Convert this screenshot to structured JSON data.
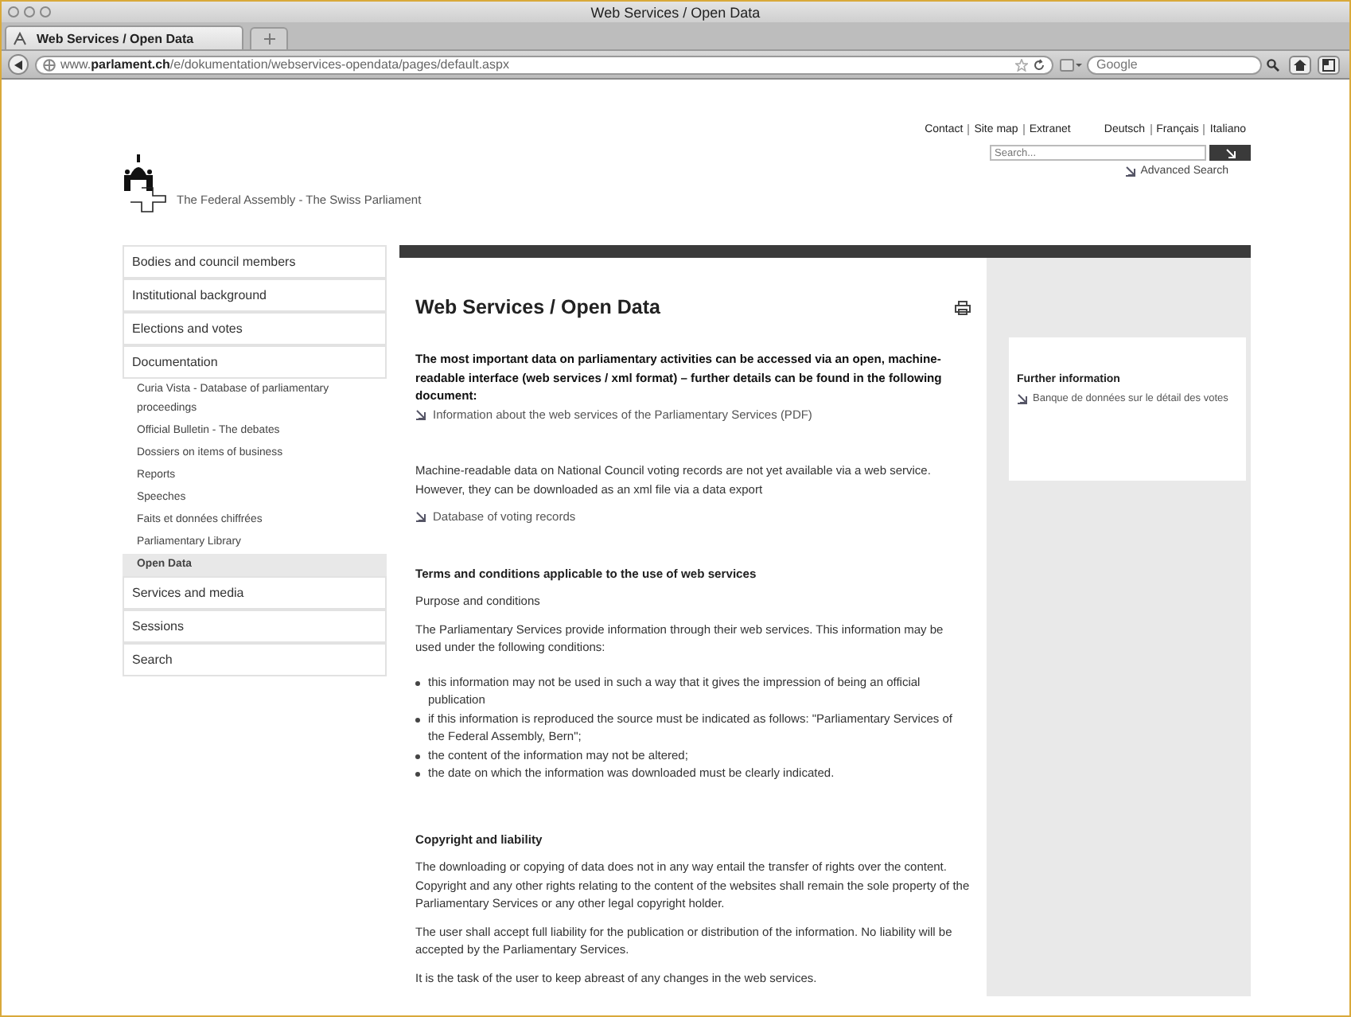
{
  "window": {
    "title": "Web Services / Open Data"
  },
  "tabs": [
    {
      "label": "Web Services / Open Data",
      "selected": true
    }
  ],
  "address_bar": {
    "url": "www.**parlament.ch**/e/dokumentation/webservices-opendata/pages/default.aspx"
  },
  "browser_search": {
    "placeholder": "Google"
  },
  "header": {
    "top_links": [
      "Contact",
      "Site map",
      "Extranet"
    ],
    "languages": [
      "Deutsch",
      "Français",
      "Italiano"
    ],
    "search": {
      "placeholder": "Search..."
    },
    "advanced_search": "Advanced Search",
    "brand": "The Federal Assembly - The Swiss Parliament"
  },
  "sidebar": {
    "items": [
      {
        "label": "Bodies and council members",
        "kind": "main",
        "selected": false
      },
      {
        "label": "Institutional background",
        "kind": "main",
        "selected": false
      },
      {
        "label": "Elections and votes",
        "kind": "main",
        "selected": false
      },
      {
        "label": "Documentation",
        "kind": "main",
        "selected": false
      },
      {
        "label": "Curia Vista - Database of parliamentary proceedings",
        "kind": "sub",
        "selected": false
      },
      {
        "label": "Official Bulletin - The debates",
        "kind": "sub",
        "selected": false
      },
      {
        "label": "Dossiers on items of business",
        "kind": "sub",
        "selected": false
      },
      {
        "label": "Reports",
        "kind": "sub",
        "selected": false
      },
      {
        "label": "Speeches",
        "kind": "sub",
        "selected": false
      },
      {
        "label": "Faits et données chiffrées",
        "kind": "sub",
        "selected": false
      },
      {
        "label": "Parliamentary Library",
        "kind": "sub",
        "selected": false
      },
      {
        "label": "Open Data",
        "kind": "sub",
        "selected": true
      },
      {
        "label": "Services and media",
        "kind": "main",
        "selected": false
      },
      {
        "label": "Sessions",
        "kind": "main",
        "selected": false
      },
      {
        "label": "Search",
        "kind": "main",
        "selected": false
      }
    ]
  },
  "content": {
    "title": "Web Services / Open Data",
    "blocks": [
      {
        "kind": "intro",
        "text": "The most important data on parliamentary activities can be accessed via an open, machine-readable interface (web services / xml format) – further details can be found in the following document:"
      },
      {
        "kind": "link",
        "text": "Information about the web services of the Parliamentary Services (PDF)"
      },
      {
        "kind": "gap"
      },
      {
        "kind": "para",
        "text": "Machine-readable data on National Council voting records are not yet available via a web service. However, they can be downloaded as an xml file via a data export"
      },
      {
        "kind": "link",
        "text": "Database of voting records"
      },
      {
        "kind": "gap"
      },
      {
        "kind": "heading",
        "text": "Terms and conditions applicable to the use of web services"
      },
      {
        "kind": "para",
        "text": "Purpose and conditions"
      },
      {
        "kind": "para",
        "text": "The Parliamentary Services provide information through their web services. This information may be used under the following conditions:"
      },
      {
        "kind": "bullets",
        "items": [
          "this information may not be used in such a way that it gives the impression of being an official publication",
          "if this information is reproduced the source must be indicated as follows: \"Parliamentary Services of the Federal Assembly, Bern\";",
          "the content of the information may not be altered;",
          "the date on which the information was downloaded must be clearly indicated."
        ]
      },
      {
        "kind": "gap"
      },
      {
        "kind": "heading",
        "text": "Copyright and liability"
      },
      {
        "kind": "para",
        "text": "The downloading or copying of data does not in any way entail the transfer of rights over the content. Copyright and any other rights relating to the content of the websites shall remain the sole property of the Parliamentary Services or any other legal copyright holder."
      },
      {
        "kind": "para",
        "text": "The user shall accept full liability for the publication or distribution of the information. No liability will be accepted by the Parliamentary Services."
      },
      {
        "kind": "para",
        "text": "It is the task of the user to keep abreast of any changes in the web services."
      }
    ]
  },
  "aside": {
    "heading": "Further information",
    "link": "Banque de données sur le détail des votes"
  }
}
